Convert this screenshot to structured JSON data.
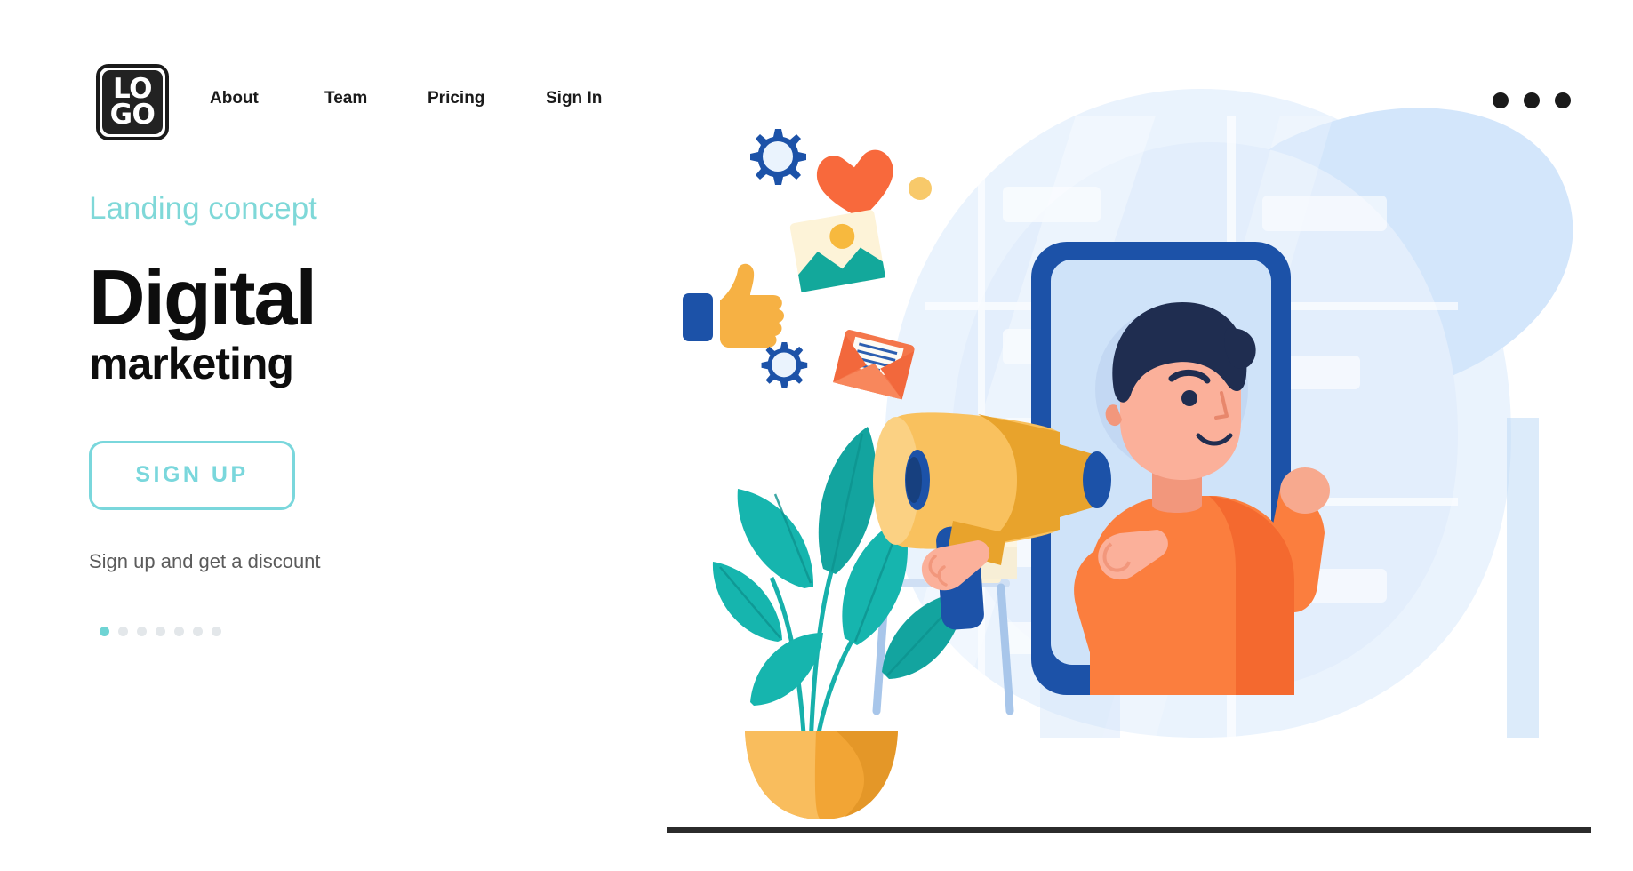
{
  "header": {
    "logo": {
      "line1": "LO",
      "line2": "GO",
      "name": "logo-badge"
    },
    "nav": [
      {
        "label": "About"
      },
      {
        "label": "Team"
      },
      {
        "label": "Pricing"
      },
      {
        "label": "Sign In"
      }
    ],
    "menu_icon": "more-horizontal-icon"
  },
  "hero": {
    "eyebrow": "Landing concept",
    "title_main": "Digital",
    "title_sub": "marketing",
    "cta_label": "SIGN UP",
    "discount_text": "Sign up and get a discount",
    "pager": {
      "count": 7,
      "active_index": 0
    }
  },
  "illustration": {
    "name": "digital-marketing-illustration",
    "elements": [
      "gear-icon",
      "heart-icon",
      "image-icon",
      "thumbs-up-icon",
      "gear-icon",
      "envelope-icon",
      "megaphone-icon",
      "smartphone-frame",
      "character-man",
      "potted-plant",
      "side-table"
    ]
  },
  "colors": {
    "accent_teal": "#7ad7dc",
    "ink": "#0d0d0d",
    "muted_text": "#5b5b5b",
    "brand_blue": "#1c52a8",
    "orange": "#f97a3d",
    "yellow": "#f4a93c",
    "plant_teal": "#17b0ab",
    "bg_blue_light": "#dbe9fa",
    "dot_inactive": "#e3e7ea"
  }
}
